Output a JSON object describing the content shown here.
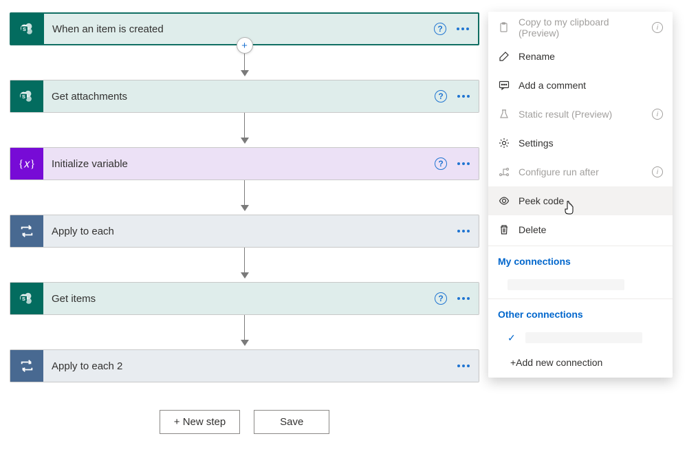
{
  "steps": [
    {
      "title": "When an item is created",
      "theme": "teal",
      "icon": "sharepoint",
      "help": true,
      "selected": true
    },
    {
      "title": "Get attachments",
      "theme": "teal",
      "icon": "sharepoint",
      "help": true,
      "selected": false
    },
    {
      "title": "Initialize variable",
      "theme": "purple",
      "icon": "variable",
      "help": true,
      "selected": false
    },
    {
      "title": "Apply to each",
      "theme": "blue",
      "icon": "loop",
      "help": false,
      "selected": false
    },
    {
      "title": "Get items",
      "theme": "teal",
      "icon": "sharepoint",
      "help": true,
      "selected": false
    },
    {
      "title": "Apply to each 2",
      "theme": "blue",
      "icon": "loop",
      "help": false,
      "selected": false
    }
  ],
  "buttons": {
    "newStep": "+ New step",
    "save": "Save"
  },
  "menu": {
    "items": [
      {
        "label": "Copy to my clipboard (Preview)",
        "icon": "copy",
        "disabled": true,
        "info": true
      },
      {
        "label": "Rename",
        "icon": "pencil",
        "disabled": false,
        "info": false
      },
      {
        "label": "Add a comment",
        "icon": "comment",
        "disabled": false,
        "info": false
      },
      {
        "label": "Static result (Preview)",
        "icon": "flask",
        "disabled": true,
        "info": true
      },
      {
        "label": "Settings",
        "icon": "gear",
        "disabled": false,
        "info": false
      },
      {
        "label": "Configure run after",
        "icon": "branch",
        "disabled": true,
        "info": true
      },
      {
        "label": "Peek code",
        "icon": "eye",
        "disabled": false,
        "info": false,
        "hovered": true
      },
      {
        "label": "Delete",
        "icon": "trash",
        "disabled": false,
        "info": false
      }
    ],
    "headings": {
      "myConnections": "My connections",
      "otherConnections": "Other connections"
    },
    "addConnection": "+Add new connection"
  }
}
